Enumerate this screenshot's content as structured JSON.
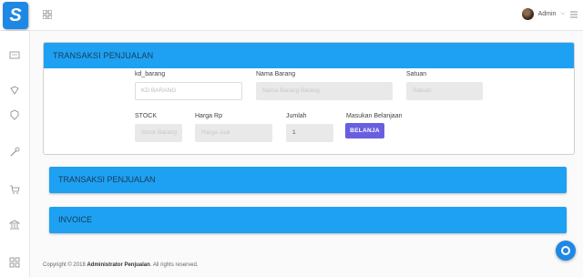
{
  "app": {
    "logo_letter": "S"
  },
  "header": {
    "user_name": "Admin",
    "user_caret": "⌵"
  },
  "form": {
    "title": "TRANSAKSI PENJUALAN",
    "kd_barang_label": "kd_barang",
    "kd_barang_placeholder": "KD BARANG",
    "nama_barang_label": "Nama Barang",
    "nama_barang_placeholder": "Nama Barang Barang",
    "satuan_label": "Satuan",
    "satuan_placeholder": "Satuan",
    "stock_label": "STOCK",
    "stock_placeholder": "Stock Barang",
    "harga_label": "Harga Rp",
    "harga_placeholder": "Harga Jual",
    "jumlah_label": "Jumlah",
    "jumlah_value": "1",
    "belanja_label": "Masukan Belanjaan",
    "belanja_button": "BELANJA"
  },
  "sections": {
    "transaksi": "TRANSAKSI PENJUALAN",
    "invoice": "INVOICE"
  },
  "footer": {
    "prefix": "Copyright © 2018",
    "owner": "Administrator Penjualan",
    "suffix": ". All rights reserved."
  },
  "icons": {
    "grid": "grid-icon",
    "menu": "menu-icon",
    "sidebar": [
      "id-card-icon",
      "diamond-icon",
      "shield-icon",
      "wrench-icon",
      "cart-icon",
      "bank-icon",
      "apps-icon"
    ],
    "fab": "settings-icon"
  },
  "colors": {
    "primary": "#1ea1f2",
    "button": "#6a5ee0",
    "logo": "#1e88e5"
  }
}
